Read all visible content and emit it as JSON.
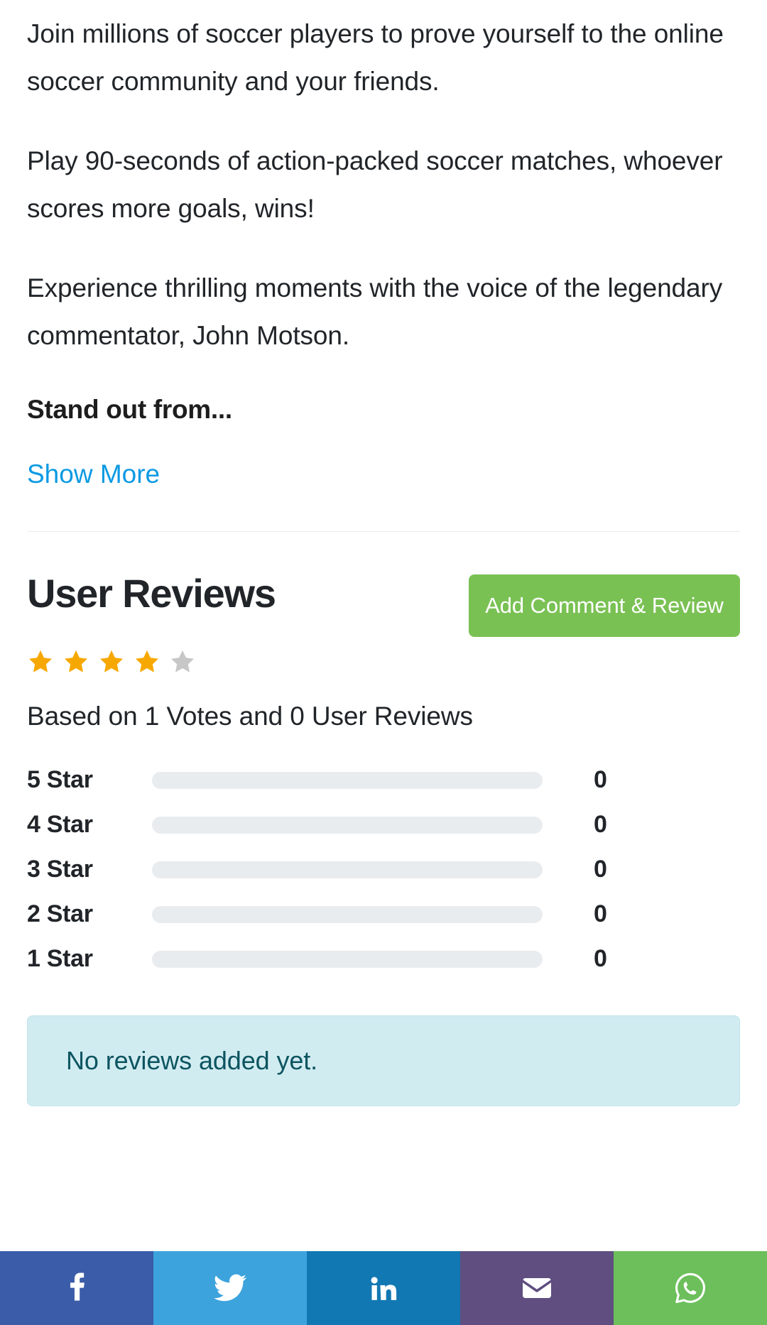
{
  "description": {
    "paragraphs": [
      "Join millions of soccer players to prove yourself to the online soccer community and your friends.",
      "Play 90-seconds of action-packed soccer matches, whoever scores more goals, wins!",
      "Experience thrilling moments with the voice of the legendary commentator, John Motson."
    ],
    "subheading": "Stand out from...",
    "show_more_label": "Show More"
  },
  "reviews": {
    "title": "User Reviews",
    "add_button_label": "Add Comment & Review",
    "rating_value": 4,
    "rating_max": 5,
    "summary_text": "Based on 1 Votes and 0 User Reviews",
    "votes": 1,
    "review_count": 0,
    "breakdown": [
      {
        "label": "5 Star",
        "count": "0",
        "percent": 0
      },
      {
        "label": "4 Star",
        "count": "0",
        "percent": 0
      },
      {
        "label": "3 Star",
        "count": "0",
        "percent": 0
      },
      {
        "label": "2 Star",
        "count": "0",
        "percent": 0
      },
      {
        "label": "1 Star",
        "count": "0",
        "percent": 0
      }
    ],
    "empty_message": "No reviews added yet."
  },
  "share": {
    "buttons": [
      {
        "name": "facebook",
        "icon": "facebook-icon",
        "color": "#3b5ca8"
      },
      {
        "name": "twitter",
        "icon": "twitter-icon",
        "color": "#3da3dd"
      },
      {
        "name": "linkedin",
        "icon": "linkedin-icon",
        "color": "#1178b3"
      },
      {
        "name": "email",
        "icon": "envelope-icon",
        "color": "#5f4e7f"
      },
      {
        "name": "whatsapp",
        "icon": "whatsapp-icon",
        "color": "#6cbf5b"
      }
    ]
  },
  "colors": {
    "link": "#0d9ae3",
    "button_green": "#7ac154",
    "star_filled": "#f7a800",
    "star_empty": "#c7c7c7",
    "alert_bg": "#d1ecf1",
    "alert_text": "#0c5460",
    "bar_track": "#e9ecef",
    "text": "#212529"
  }
}
